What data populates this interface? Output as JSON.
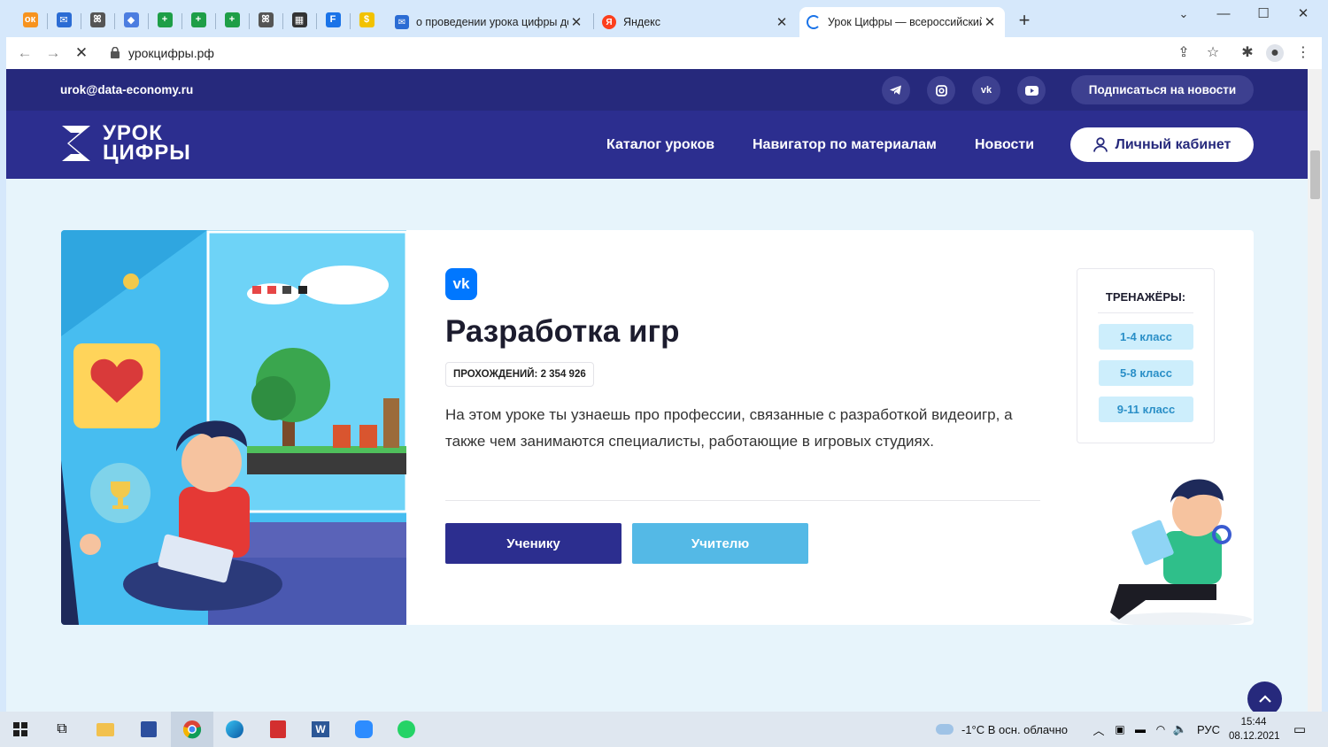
{
  "browser": {
    "pinned_tabs": [
      {
        "icon": "odnoklassniki-icon",
        "color": "#f7931e",
        "glyph": "ок"
      },
      {
        "icon": "mail-icon",
        "color": "#2b6cd4",
        "glyph": "✉"
      },
      {
        "icon": "butterfly-icon",
        "color": "#555555",
        "glyph": "ꕤ"
      },
      {
        "icon": "diamond-icon",
        "color": "#4c7de0",
        "glyph": "◆"
      },
      {
        "icon": "sheets-icon",
        "color": "#1e9e47",
        "glyph": "+"
      },
      {
        "icon": "sheets-icon",
        "color": "#1e9e47",
        "glyph": "+"
      },
      {
        "icon": "sheets-icon",
        "color": "#1e9e47",
        "glyph": "+"
      },
      {
        "icon": "butterfly-icon",
        "color": "#555555",
        "glyph": "ꕤ"
      },
      {
        "icon": "qr-icon",
        "color": "#333333",
        "glyph": "▦"
      },
      {
        "icon": "forms-icon",
        "color": "#1a73e8",
        "glyph": "F"
      },
      {
        "icon": "money-icon",
        "color": "#f2c200",
        "glyph": "$"
      }
    ],
    "tabs": [
      {
        "title": "о проведении урока цифры до",
        "favicon_color": "#2b6cd4",
        "favicon_glyph": "✉"
      },
      {
        "title": "Яндекс",
        "favicon_color": "#fc3f1d",
        "favicon_glyph": "Я"
      },
      {
        "title": "Урок Цифры — всероссийский",
        "favicon_color": "#1a73e8",
        "favicon_glyph": ""
      }
    ],
    "url": "урокцифры.рф"
  },
  "site": {
    "email": "urok@data-economy.ru",
    "subscribe_label": "Подписаться на новости",
    "logo_line1": "УРОК",
    "logo_line2": "ЦИФРЫ",
    "nav": {
      "catalog": "Каталог уроков",
      "navigator": "Навигатор по материалам",
      "news": "Новости",
      "cabinet": "Личный кабинет"
    },
    "colors": {
      "topbar": "#26297c",
      "nav": "#2c2e8f",
      "page_bg": "#e7f4fb",
      "accent_light": "#54b9e6",
      "vk": "#0077ff"
    }
  },
  "lesson": {
    "partner_logo": "vk-icon",
    "title": "Разработка игр",
    "passes_label": "ПРОХОЖДЕНИЙ: 2 354 926",
    "description": "На этом уроке ты узнаешь про профессии, связанные с разработкой видеоигр, а также чем занимаются специалисты, работающие в игровых студиях.",
    "student_button": "Ученику",
    "teacher_button": "Учителю",
    "trainers_title": "ТРЕНАЖЁРЫ:",
    "grades": [
      "1-4 класс",
      "5-8 класс",
      "9-11 класс"
    ]
  },
  "taskbar": {
    "weather": "-1°C  В осн. облачно",
    "language": "РУС",
    "time": "15:44",
    "date": "08.12.2021"
  }
}
